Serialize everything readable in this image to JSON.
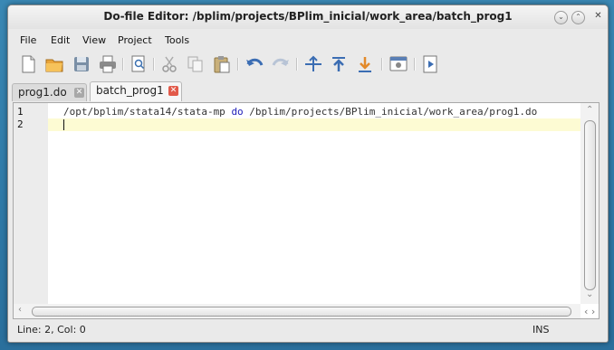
{
  "window": {
    "title": "Do-file Editor: /bplim/projects/BPlim_inicial/work_area/batch_prog1",
    "controls": [
      "minimize-icon",
      "maximize-icon",
      "close-icon"
    ]
  },
  "menu": {
    "file": "File",
    "edit": "Edit",
    "view": "View",
    "project": "Project",
    "tools": "Tools"
  },
  "toolbar": {
    "buttons": [
      "new-file-icon",
      "open-folder-icon",
      "save-icon",
      "print-icon",
      "find-icon",
      "cut-icon",
      "copy-icon",
      "paste-icon",
      "undo-icon",
      "redo-icon",
      "indent-icon",
      "shift-up-icon",
      "shift-down-icon",
      "preview-icon",
      "execute-icon"
    ]
  },
  "tabs": [
    {
      "label": "prog1.do",
      "active": false
    },
    {
      "label": "batch_prog1",
      "active": true
    }
  ],
  "editor": {
    "line_numbers": [
      "1",
      "2"
    ],
    "line1": {
      "part1": "/opt/bplim/stata14/stata-mp ",
      "keyword": "do",
      "part2": " /bplim/projects/BPlim_inicial/work_area/prog1.do"
    },
    "line2": "",
    "current_line_color": "#fdfbd3",
    "keyword_color": "#1b1bb8"
  },
  "status": {
    "position": "Line: 2, Col: 0",
    "mode": "INS"
  },
  "colors": {
    "desktop": "#2f7aa8",
    "tab_close_inactive": "#a8a8a8",
    "tab_close_active": "#e25a4a"
  }
}
